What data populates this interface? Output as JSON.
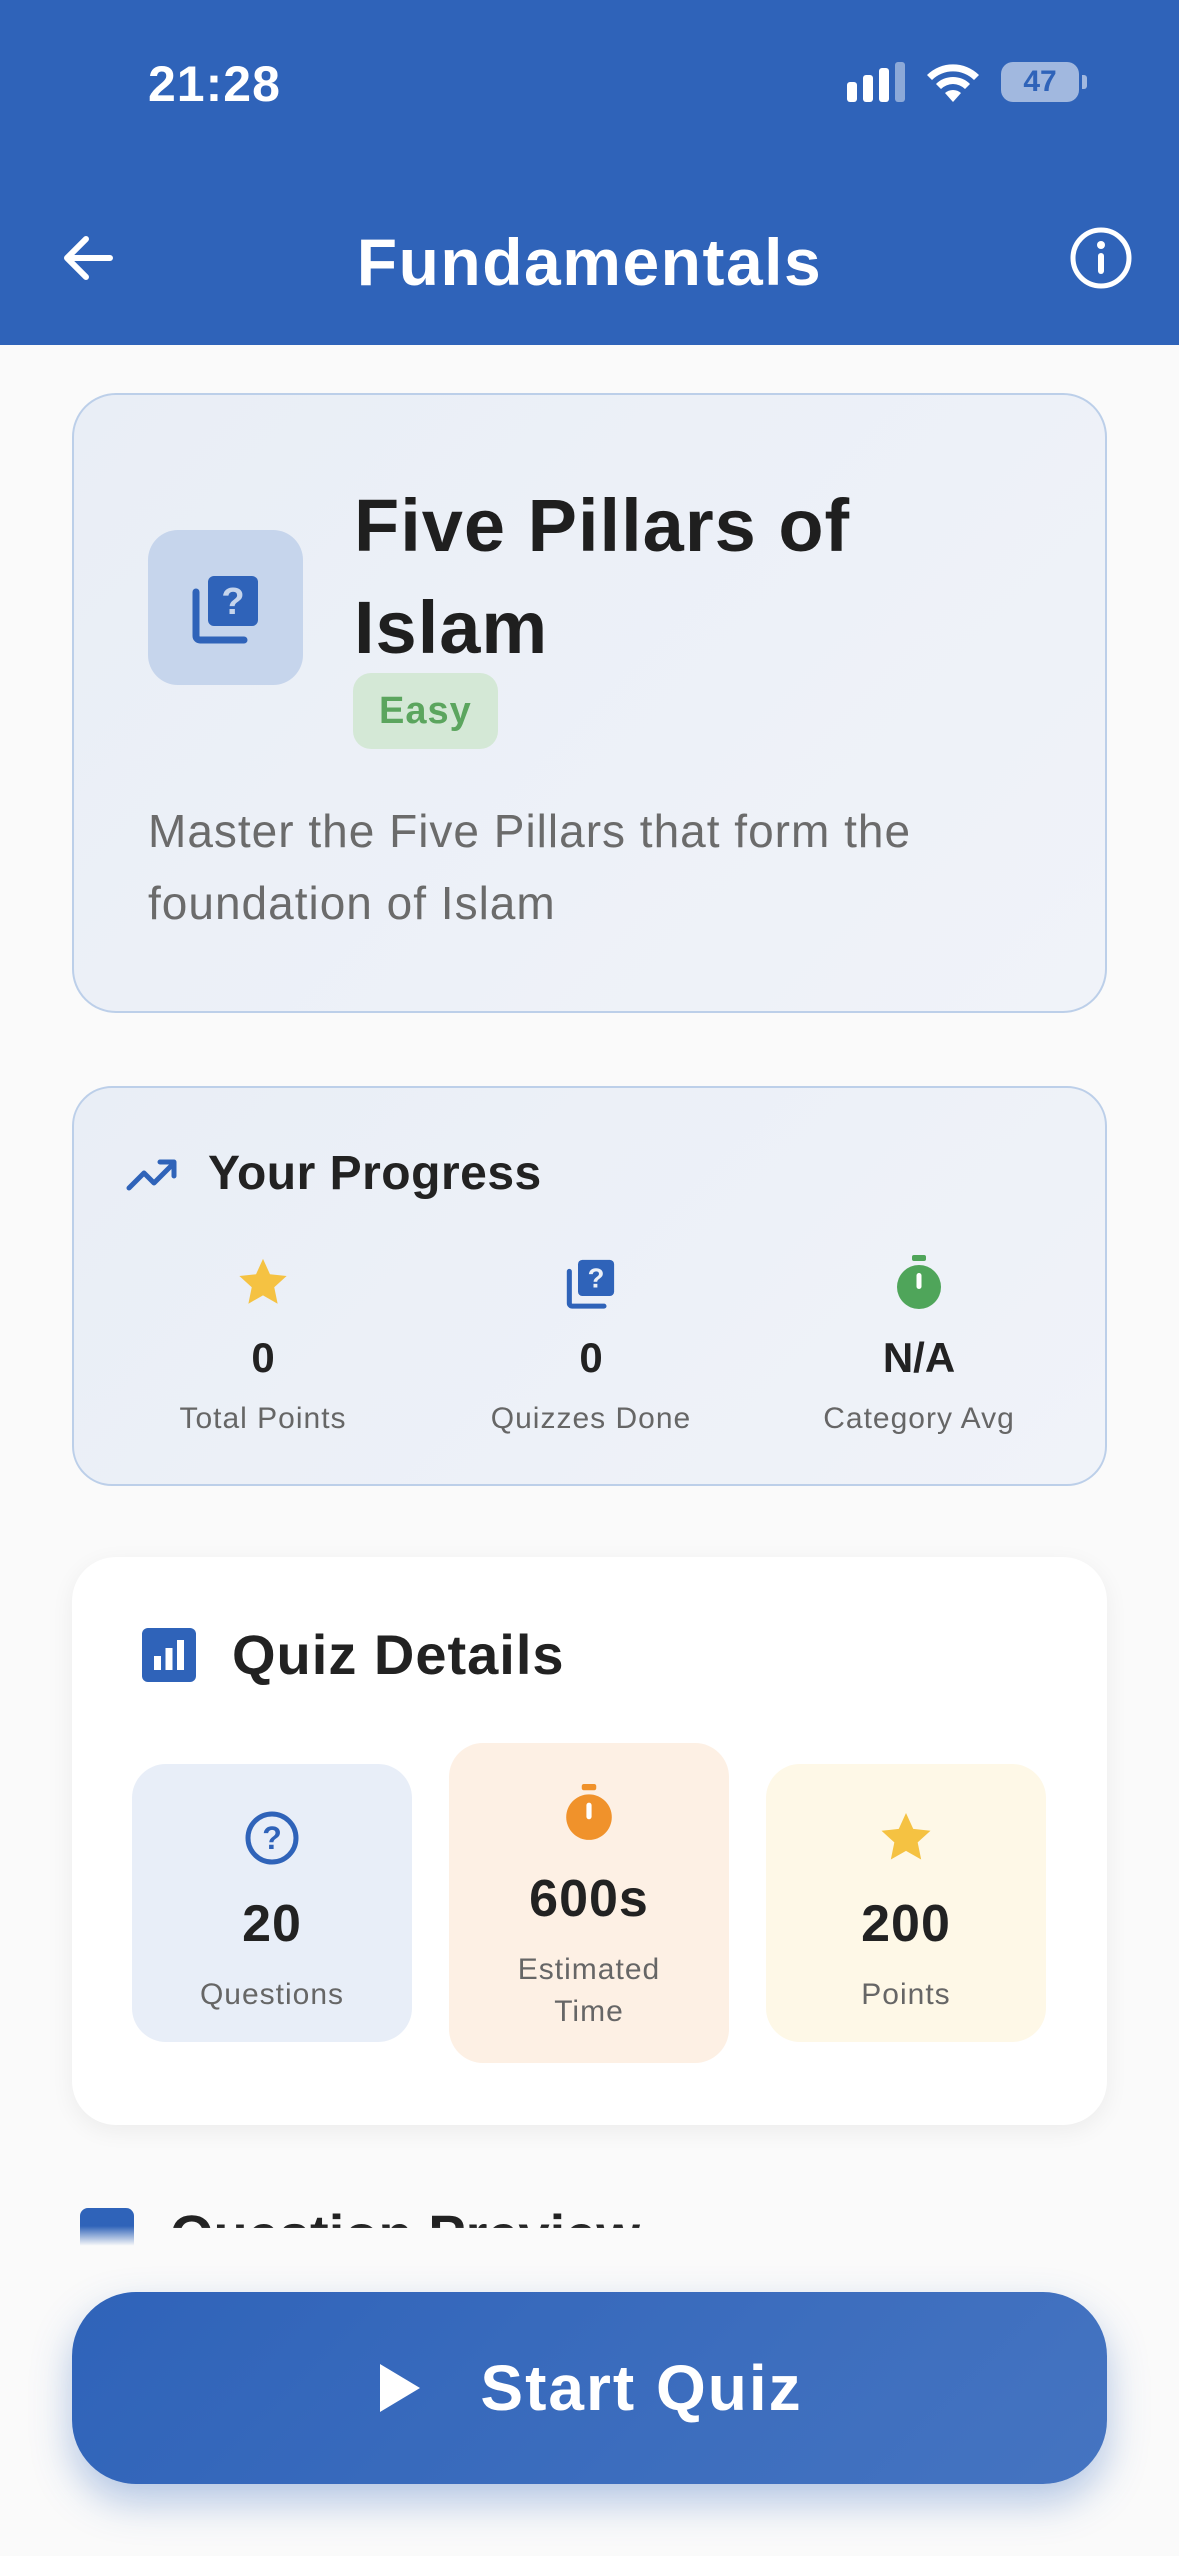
{
  "status_bar": {
    "time": "21:28",
    "battery": "47"
  },
  "header": {
    "title": "Fundamentals"
  },
  "quiz": {
    "title_line1": "Five Pillars of",
    "title_line2": "Islam",
    "difficulty": "Easy",
    "description_line1": "Master the Five Pillars that form the",
    "description_line2": "foundation of Islam"
  },
  "progress": {
    "title": "Your Progress",
    "stats": [
      {
        "value": "0",
        "label": "Total Points",
        "icon": "star-icon"
      },
      {
        "value": "0",
        "label": "Quizzes Done",
        "icon": "quiz-icon"
      },
      {
        "value": "N/A",
        "label": "Category Avg",
        "icon": "timer-icon"
      }
    ]
  },
  "details": {
    "title": "Quiz Details",
    "tiles": [
      {
        "value": "20",
        "label": "Questions",
        "icon": "question-icon"
      },
      {
        "value": "600s",
        "label_line1": "Estimated",
        "label_line2": "Time",
        "icon": "timer-icon"
      },
      {
        "value": "200",
        "label": "Points",
        "icon": "star-icon"
      }
    ]
  },
  "next_section": {
    "title": "Question Preview"
  },
  "actions": {
    "start_label": "Start Quiz"
  },
  "colors": {
    "primary": "#2f63b9",
    "easy_green": "#5ba55e",
    "star_yellow": "#f5c242",
    "timer_orange": "#f0922b",
    "timer_green": "#4fa55a"
  }
}
